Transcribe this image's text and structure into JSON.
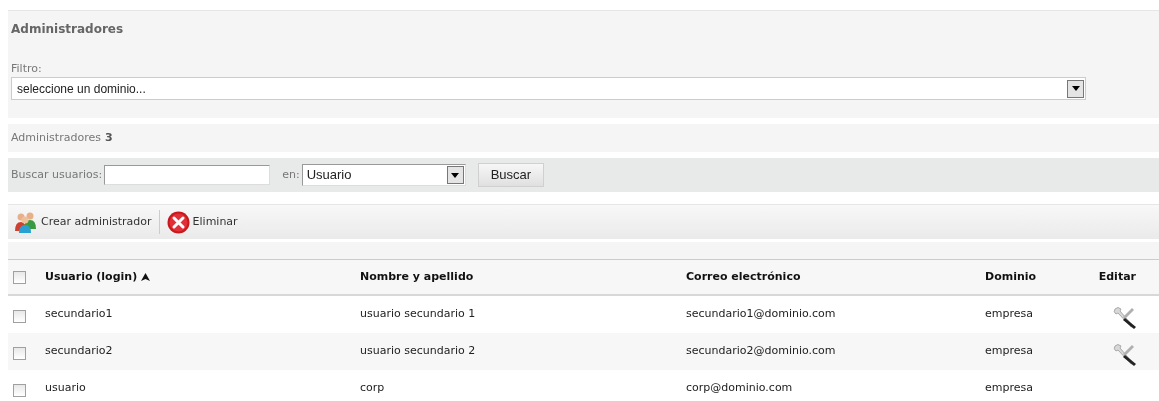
{
  "title": "Administradores",
  "filter": {
    "label": "Filtro:",
    "value": "seleccione un dominio..."
  },
  "count": {
    "label": "Administradores",
    "value": "3"
  },
  "search": {
    "label": "Buscar usuarios:",
    "in_label": "en:",
    "field": "Usuario",
    "button": "Buscar"
  },
  "toolbar": [
    {
      "kind": "create",
      "label": "Crear administrador"
    },
    {
      "kind": "delete",
      "label": "Eliminar"
    }
  ],
  "table": {
    "select_all": {
      "checked": false
    },
    "columns": [
      {
        "label": "Usuario (login)",
        "sorted": true
      },
      {
        "label": "Nombre y apellido",
        "sorted": false
      },
      {
        "label": "Correo electrónico",
        "sorted": false
      },
      {
        "label": "Dominio",
        "sorted": false
      },
      {
        "label": "Editar",
        "sorted": false
      }
    ],
    "rows": [
      {
        "checked": false,
        "login": "secundario1",
        "name": "usuario secundario 1",
        "email": "secundario1@dominio.com",
        "domain": "empresa",
        "editable": true
      },
      {
        "checked": false,
        "login": "secundario2",
        "name": "usuario secundario 2",
        "email": "secundario2@dominio.com",
        "domain": "empresa",
        "editable": true
      },
      {
        "checked": false,
        "login": "usuario",
        "name": "corp",
        "email": "corp@dominio.com",
        "domain": "empresa",
        "editable": false
      }
    ]
  }
}
